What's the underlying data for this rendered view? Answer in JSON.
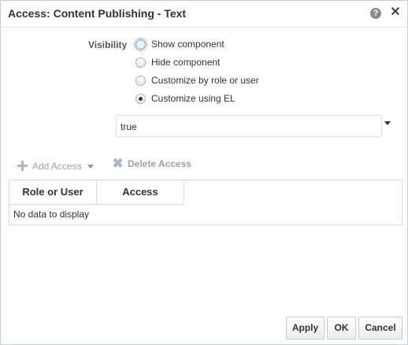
{
  "dialog": {
    "title": "Access: Content Publishing - Text",
    "help_icon": "help-icon",
    "close_icon": "close-icon"
  },
  "visibility": {
    "label": "Visibility",
    "options": [
      {
        "label": "Show component",
        "selected": false,
        "focused": true
      },
      {
        "label": "Hide component",
        "selected": false
      },
      {
        "label": "Customize by role or user",
        "selected": false
      },
      {
        "label": "Customize using EL",
        "selected": true
      }
    ],
    "el_value": "true"
  },
  "toolbar": {
    "add_label": "Add Access",
    "delete_label": "Delete Access"
  },
  "table": {
    "columns": [
      "Role or User",
      "Access"
    ],
    "empty_text": "No data to display"
  },
  "buttons": {
    "apply": "Apply",
    "ok": "OK",
    "cancel": "Cancel"
  },
  "colors": {
    "border": "#c4ced7",
    "disabled_text": "#9aa3ab"
  }
}
